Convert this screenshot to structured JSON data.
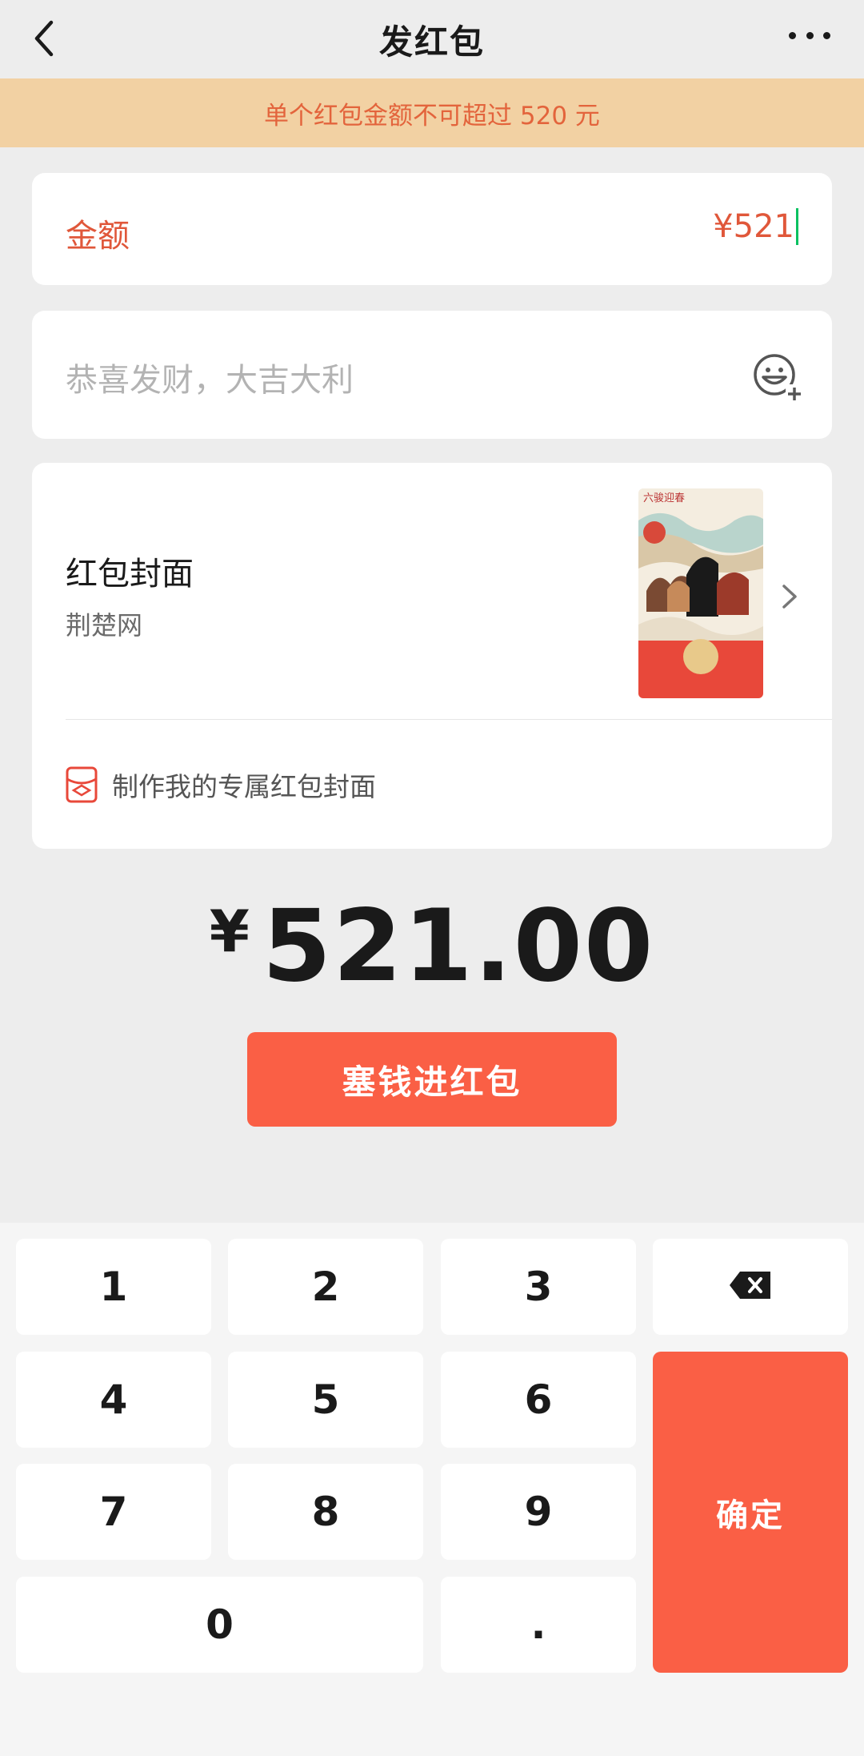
{
  "header": {
    "title": "发红包"
  },
  "notice": "单个红包金额不可超过 520 元",
  "amount": {
    "label": "金额",
    "value": "¥521"
  },
  "greeting": {
    "placeholder": "恭喜发财，大吉大利"
  },
  "cover": {
    "title": "红包封面",
    "subtitle": "荆楚网",
    "make_label": "制作我的专属红包封面"
  },
  "total": {
    "currency": "¥",
    "value": "521.00"
  },
  "send_button": "塞钱进红包",
  "keypad": {
    "k1": "1",
    "k2": "2",
    "k3": "3",
    "k4": "4",
    "k5": "5",
    "k6": "6",
    "k7": "7",
    "k8": "8",
    "k9": "9",
    "k0": "0",
    "dot": ".",
    "confirm": "确定"
  },
  "colors": {
    "accent": "#fa5f45",
    "notice_bg": "#f2d1a3",
    "notice_text": "#e3643c",
    "caret": "#07c160"
  },
  "icons": [
    "back-arrow-icon",
    "more-dots-icon",
    "emoji-add-icon",
    "chevron-right-icon",
    "cover-make-icon",
    "backspace-icon"
  ]
}
